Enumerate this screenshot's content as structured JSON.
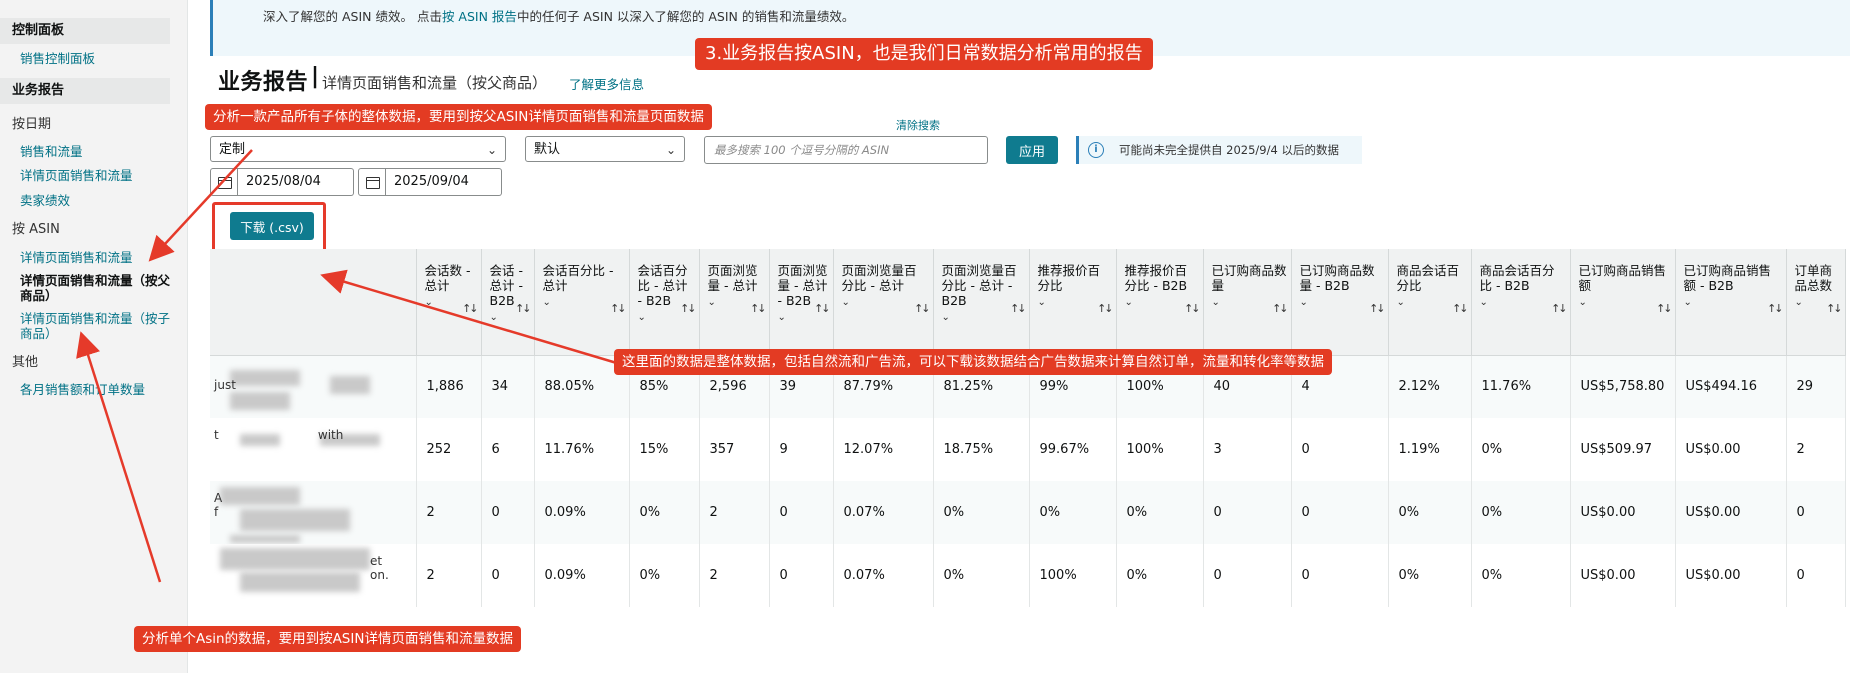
{
  "sidebar": {
    "dashboard_section": "控制面板",
    "dashboard_link": "销售控制面板",
    "reports_section": "业务报告",
    "by_date_group": "按日期",
    "by_date_items": [
      "销售和流量",
      "详情页面销售和流量",
      "卖家绩效"
    ],
    "by_asin_group": "按 ASIN",
    "by_asin_items": [
      "详情页面销售和流量",
      "详情页面销售和流量（按父商品）",
      "详情页面销售和流量（按子商品）"
    ],
    "other_group": "其他",
    "other_items": [
      "各月销售额和订单数量"
    ]
  },
  "banner": {
    "text_before": "深入了解您的 ASIN 绩效。 点击",
    "link": "按 ASIN 报告",
    "text_after": "中的任何子 ASIN 以深入了解您的 ASIN 的销售和流量绩效。"
  },
  "header": {
    "title": "业务报告",
    "separator": "|",
    "subtitle": "详情页面销售和流量（按父商品）",
    "learn_more": "了解更多信息"
  },
  "filters": {
    "range_select": "定制",
    "view_select": "默认",
    "clear_search": "清除搜索",
    "search_placeholder": "最多搜索 100 个逗号分隔的 ASIN",
    "apply": "应用",
    "notice": "可能尚未完全提供自 2025/9/4 以后的数据",
    "notice_icon": "info-icon",
    "start_date": "2025/08/04",
    "end_date": "2025/09/04",
    "download": "下载 (.csv)"
  },
  "table": {
    "headers": [
      "会话数 - 总计",
      "会话 - 总计 - B2B",
      "会话百分比 - 总计",
      "会话百分比 - 总计 - B2B",
      "页面浏览量 - 总计",
      "页面浏览量 - 总计 - B2B",
      "页面浏览量百分比 - 总计",
      "页面浏览量百分比 - 总计 - B2B",
      "推荐报价百分比",
      "推荐报价百分比 - B2B",
      "已订购商品数量",
      "已订购商品数量 - B2B",
      "商品会话百分比",
      "商品会话百分比 - B2B",
      "已订购商品销售额",
      "已订购商品销售额 - B2B",
      "订单商品总数"
    ],
    "rows": [
      {
        "product_text": "just",
        "cells": [
          "1,886",
          "34",
          "88.05%",
          "85%",
          "2,596",
          "39",
          "87.79%",
          "81.25%",
          "99%",
          "100%",
          "40",
          "4",
          "2.12%",
          "11.76%",
          "US$5,758.80",
          "US$494.16",
          "29"
        ]
      },
      {
        "product_text": "t                          with",
        "cells": [
          "252",
          "6",
          "11.76%",
          "15%",
          "357",
          "9",
          "12.07%",
          "18.75%",
          "99.67%",
          "100%",
          "3",
          "0",
          "1.19%",
          "0%",
          "US$509.97",
          "US$0.00",
          "2"
        ]
      },
      {
        "product_text": "A\nf",
        "cells": [
          "2",
          "0",
          "0.09%",
          "0%",
          "2",
          "0",
          "0.07%",
          "0%",
          "0%",
          "0%",
          "0",
          "0",
          "0%",
          "0%",
          "US$0.00",
          "US$0.00",
          "0"
        ]
      },
      {
        "product_text": "et\non.",
        "cells": [
          "2",
          "0",
          "0.09%",
          "0%",
          "2",
          "0",
          "0.07%",
          "0%",
          "100%",
          "0%",
          "0",
          "0",
          "0%",
          "0%",
          "US$0.00",
          "US$0.00",
          "0"
        ]
      }
    ]
  },
  "annotations": {
    "top": "3.业务报告按ASIN，也是我们日常数据分析常用的报告",
    "parent": "分析一款产品所有子体的整体数据，要用到按父ASIN详情页面销售和流量页面数据",
    "middle": "这里面的数据是整体数据，包括自然流和广告流，可以下载该数据结合广告数据来计算自然订单，流量和转化率等数据",
    "bottom": "分析单个Asin的数据，要用到按ASIN详情页面销售和流量数据"
  },
  "colors": {
    "annotation_red": "#e33b23",
    "teal_button": "#0f7b8f",
    "link": "#007185"
  }
}
